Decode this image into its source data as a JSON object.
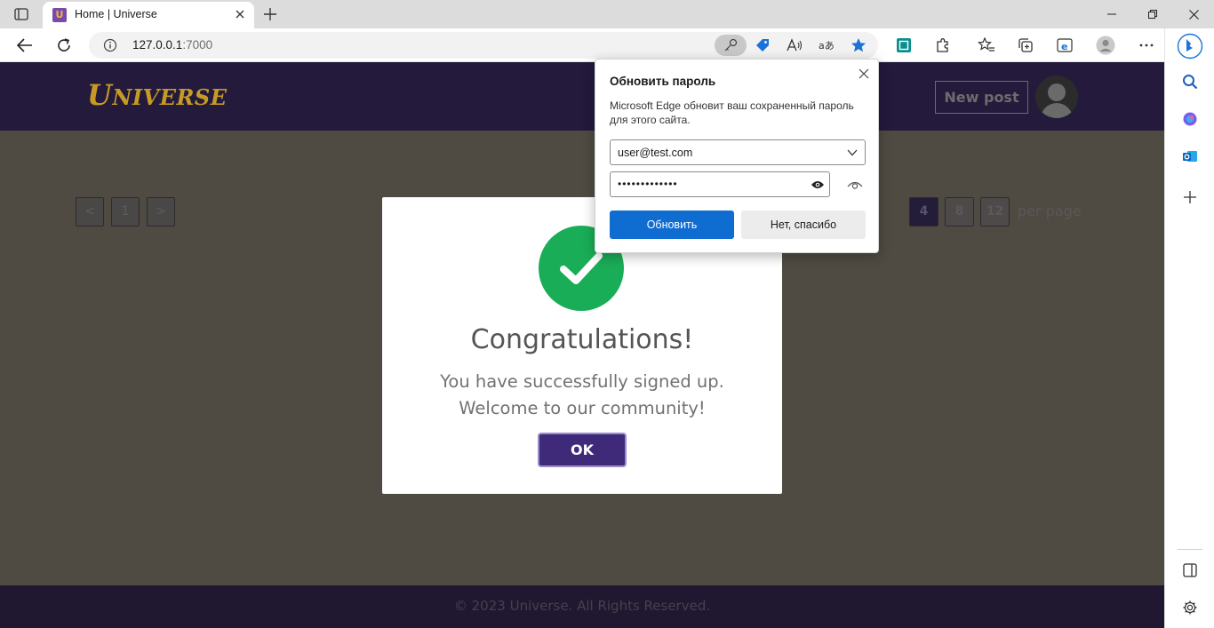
{
  "browser": {
    "tab": {
      "title": "Home | Universe",
      "favicon_letter": "U"
    },
    "address": {
      "host": "127.0.0.1",
      "port": ":7000"
    }
  },
  "site": {
    "logo": {
      "first": "U",
      "rest": "NIVERSE"
    },
    "new_post_label": "New post",
    "pager": {
      "prev": "<",
      "page": "1",
      "next": ">"
    },
    "per_page": {
      "options": [
        "4",
        "8",
        "12"
      ],
      "selected": "4",
      "label": "per page"
    },
    "footer": "© 2023 Universe. All Rights Reserved."
  },
  "modal": {
    "title": "Congratulations!",
    "line1": "You have successfully signed up.",
    "line2": "Welcome to our community!",
    "ok_label": "OK"
  },
  "password_popup": {
    "title": "Обновить пароль",
    "description": "Microsoft Edge обновит ваш сохраненный пароль для этого сайта.",
    "username": "user@test.com",
    "password_masked": "•••••••••••••",
    "update_label": "Обновить",
    "decline_label": "Нет, спасибо"
  },
  "colors": {
    "header_bg": "#231a3c",
    "accent_purple": "#3f2a7a",
    "success_green": "#1aad57",
    "edge_blue": "#0f6cd0",
    "logo_gold": "#c79a26"
  }
}
